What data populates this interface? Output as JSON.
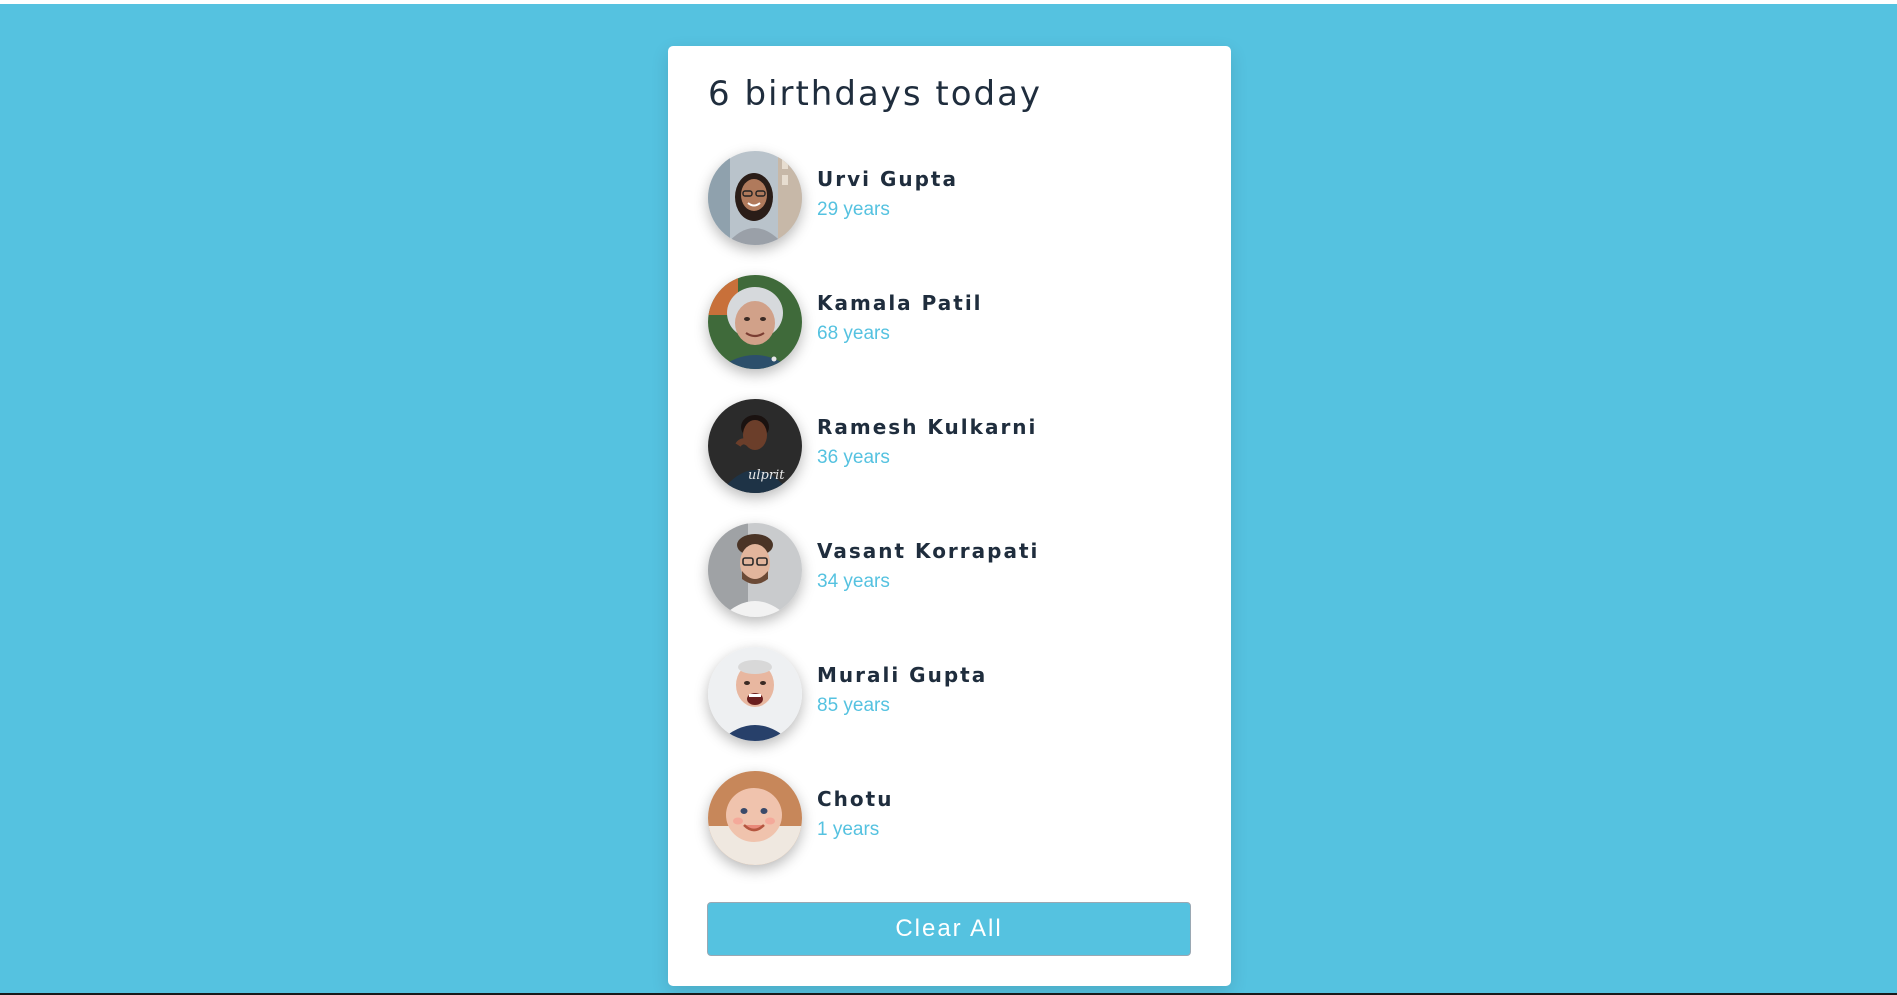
{
  "heading": "6 birthdays today",
  "people": [
    {
      "name": "Urvi Gupta",
      "age": "29 years"
    },
    {
      "name": "Kamala Patil",
      "age": "68 years"
    },
    {
      "name": "Ramesh Kulkarni",
      "age": "36 years"
    },
    {
      "name": "Vasant Korrapati",
      "age": "34 years"
    },
    {
      "name": "Murali Gupta",
      "age": "85 years"
    },
    {
      "name": "Chotu",
      "age": "1 years"
    }
  ],
  "clear_button_label": "Clear All",
  "colors": {
    "background": "#55c2e0",
    "accent": "#55c2e0",
    "heading_text": "#1f2d3d",
    "card": "#ffffff"
  }
}
